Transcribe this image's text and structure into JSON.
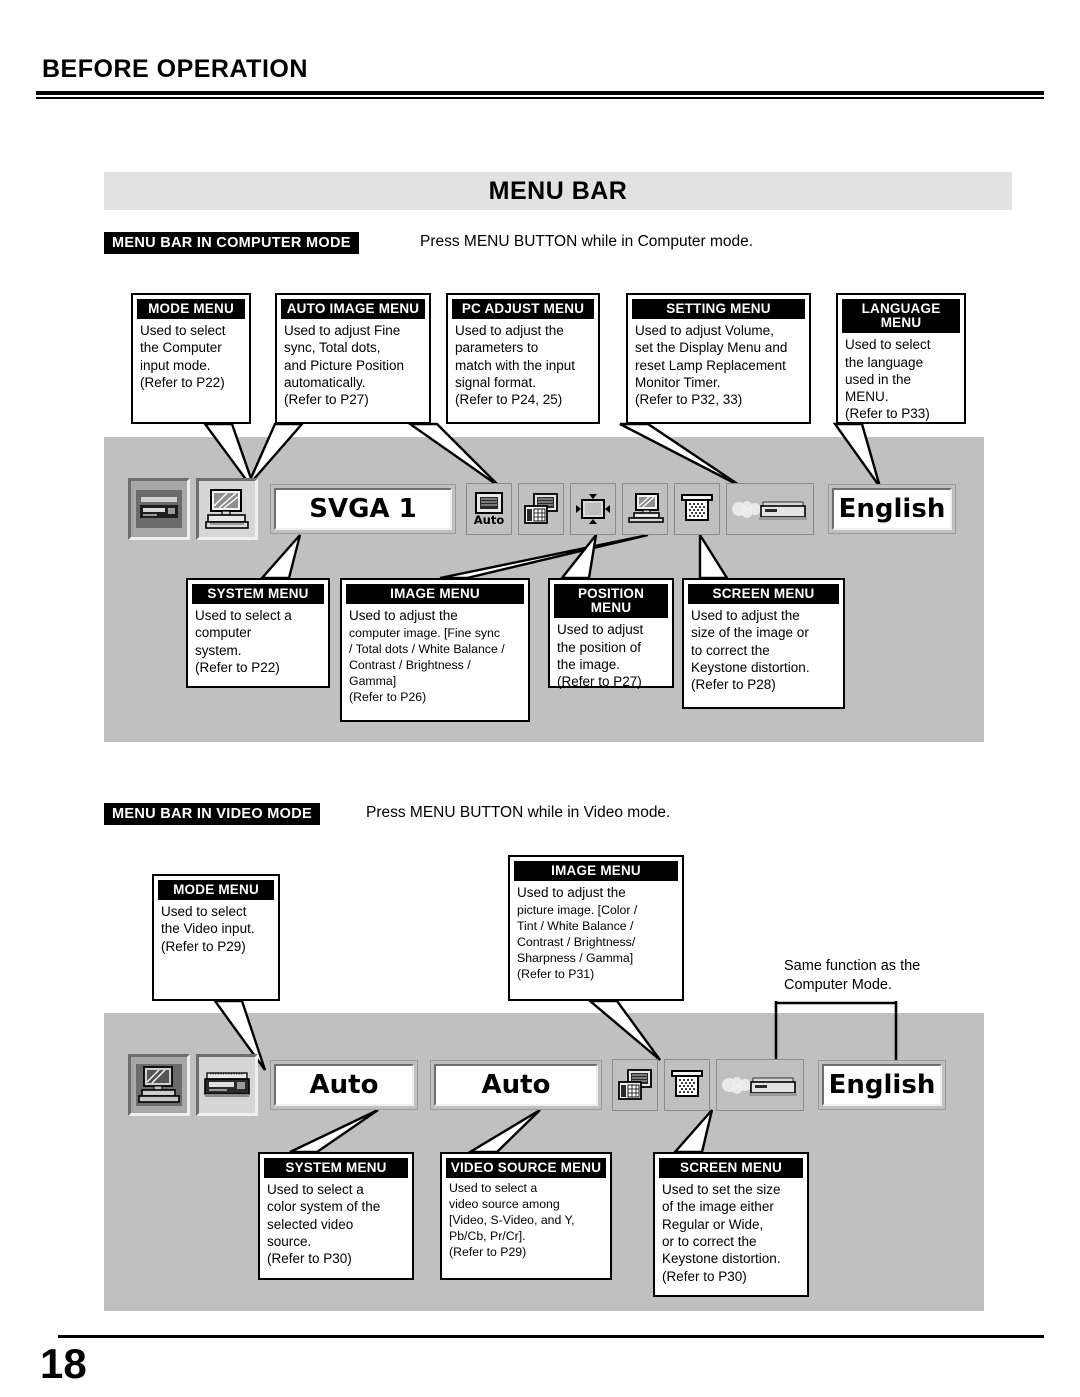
{
  "page": {
    "header_title": "BEFORE OPERATION",
    "section_banner": "MENU BAR",
    "page_number": "18"
  },
  "computer_mode": {
    "tag": "MENU BAR IN COMPUTER MODE",
    "note": "Press MENU BUTTON while in Computer mode.",
    "menubar": {
      "icons": [
        {
          "name": "video-input-icon",
          "label": ""
        },
        {
          "name": "computer-input-icon",
          "label": ""
        },
        {
          "name": "system-field",
          "label": "SVGA 1"
        },
        {
          "name": "auto-image-icon",
          "label": "Auto"
        },
        {
          "name": "pc-adjust-icon",
          "label": ""
        },
        {
          "name": "position-icon",
          "label": ""
        },
        {
          "name": "image-icon",
          "label": ""
        },
        {
          "name": "screen-icon",
          "label": ""
        },
        {
          "name": "setting-icon",
          "label": ""
        },
        {
          "name": "language-field",
          "label": "English"
        }
      ]
    },
    "callouts_top": [
      {
        "title": "MODE MENU",
        "body": "Used to select\nthe Computer\ninput mode.\n(Refer to P22)"
      },
      {
        "title": "AUTO IMAGE MENU",
        "body": "Used to adjust Fine\nsync, Total dots,\nand Picture Position\nautomatically.\n(Refer to P27)"
      },
      {
        "title": "PC ADJUST MENU",
        "body": "Used to adjust the\nparameters to\nmatch with the input\nsignal format.\n(Refer to P24, 25)"
      },
      {
        "title": "SETTING MENU",
        "body": "Used to adjust Volume,\nset the Display Menu and\nreset Lamp Replacement\nMonitor Timer.\n(Refer to P32, 33)"
      },
      {
        "title": "LANGUAGE MENU",
        "body": "Used to select\nthe language\nused in the\nMENU.\n(Refer to P33)"
      }
    ],
    "callouts_bottom": [
      {
        "title": "SYSTEM MENU",
        "body": "Used to select a\ncomputer\nsystem.\n(Refer to P22)"
      },
      {
        "title": "IMAGE MENU",
        "body_line1": "Used to adjust the",
        "body": "computer image. [Fine sync\n/ Total dots / White Balance /\nContrast / Brightness /\nGamma]\n(Refer to P26)"
      },
      {
        "title": "POSITION MENU",
        "body": "Used to adjust\nthe position of\nthe image.\n(Refer to P27)"
      },
      {
        "title": "SCREEN MENU",
        "body": "Used to adjust the\nsize of the image or\nto correct the\nKeystone distortion.\n(Refer to P28)"
      }
    ]
  },
  "video_mode": {
    "tag": "MENU BAR IN VIDEO MODE",
    "note": "Press MENU BUTTON while in Video mode.",
    "same_function_note": "Same function as the\nComputer Mode.",
    "menubar": {
      "icons": [
        {
          "name": "computer-input-icon",
          "label": ""
        },
        {
          "name": "video-input-icon",
          "label": ""
        },
        {
          "name": "system-field",
          "label": "Auto"
        },
        {
          "name": "video-source-field",
          "label": "Auto"
        },
        {
          "name": "image-icon",
          "label": ""
        },
        {
          "name": "screen-icon",
          "label": ""
        },
        {
          "name": "setting-icon",
          "label": ""
        },
        {
          "name": "language-field",
          "label": "English"
        }
      ]
    },
    "callouts_top": [
      {
        "title": "MODE MENU",
        "body": "Used to select\nthe Video input.\n(Refer to P29)"
      },
      {
        "title": "IMAGE MENU",
        "body_line1": "Used to adjust the",
        "body": "picture image.  [Color /\nTint / White Balance /\nContrast / Brightness/\nSharpness / Gamma]\n(Refer to P31)"
      }
    ],
    "callouts_bottom": [
      {
        "title": "SYSTEM MENU",
        "body": "Used to select a\ncolor system of the\nselected video\nsource.\n(Refer to P30)"
      },
      {
        "title": "VIDEO SOURCE MENU",
        "body": "Used to select a\nvideo source among\n[Video, S-Video, and Y,\nPb/Cb, Pr/Cr].\n(Refer to P29)"
      },
      {
        "title": "SCREEN MENU",
        "body": "Used to set the size\nof the image either\nRegular or  Wide,\nor to correct the\nKeystone distortion.\n(Refer to P30)"
      }
    ]
  }
}
